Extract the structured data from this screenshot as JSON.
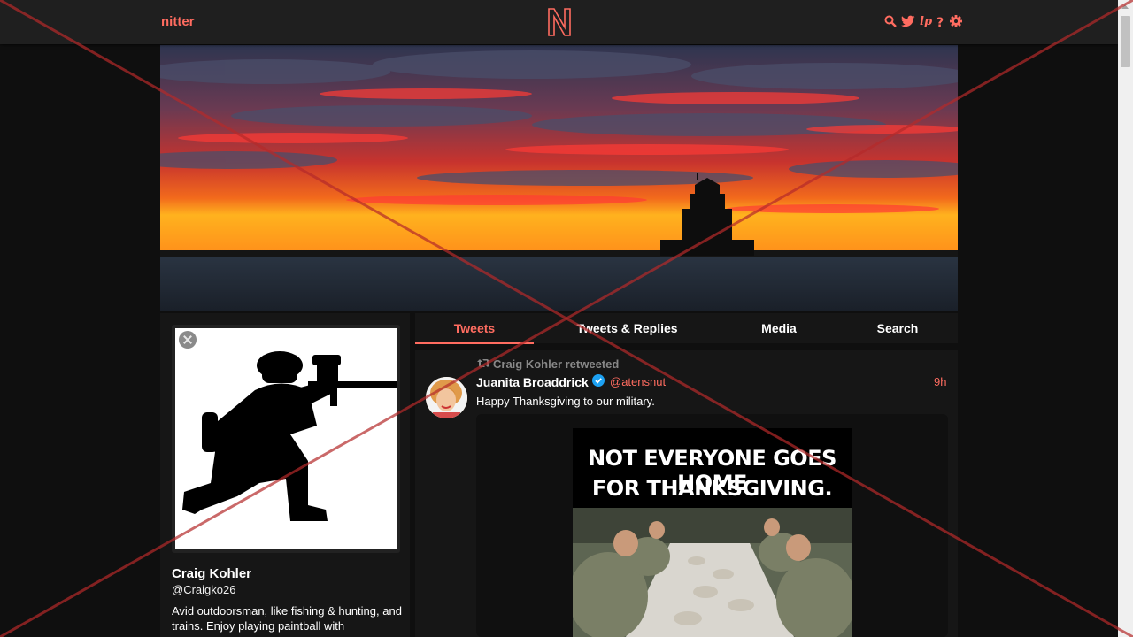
{
  "nav": {
    "brand": "nitter",
    "icons": [
      "search-icon",
      "twitter-icon",
      "liberapay-icon",
      "help-icon",
      "settings-icon"
    ]
  },
  "profile": {
    "fullname": "Craig Kohler",
    "username": "@Craigko26",
    "bio": "Avid outdoorsman, like fishing & hunting, and trains. Enjoy playing paintball with"
  },
  "tabs": [
    {
      "label": "Tweets",
      "active": true
    },
    {
      "label": "Tweets & Replies",
      "active": false
    },
    {
      "label": "Media",
      "active": false
    },
    {
      "label": "Search",
      "active": false
    }
  ],
  "tweet": {
    "retweet_header": "Craig Kohler retweeted",
    "fullname": "Juanita Broaddrick",
    "verified": true,
    "handle": "@atensnut",
    "date": "9h",
    "text": "Happy Thanksgiving to our military.",
    "image_text_line1": "NOT EVERYONE GOES HOME",
    "image_text_line2": "FOR THANKSGIVING."
  },
  "colors": {
    "accent": "#ff6c60",
    "background": "#0f0f0f",
    "panel": "#161616",
    "navbar": "#1f1f1f"
  }
}
